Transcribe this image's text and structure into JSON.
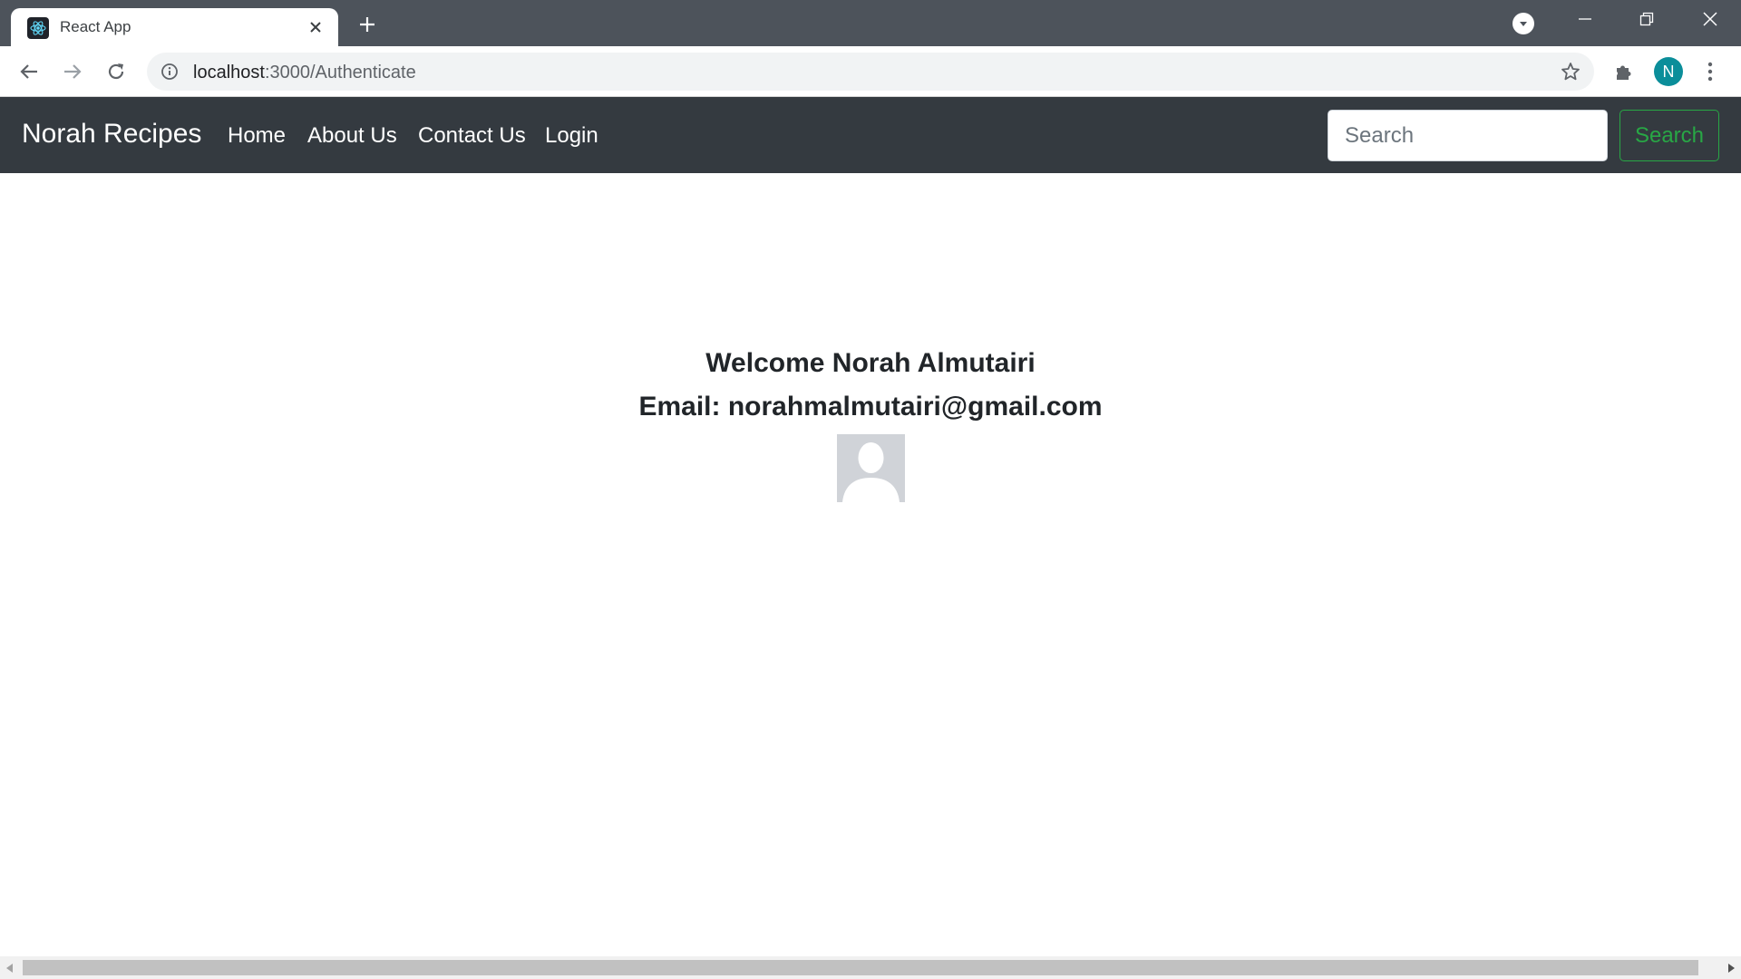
{
  "browser": {
    "tab_title": "React App",
    "url_host": "localhost",
    "url_path": ":3000/Authenticate",
    "profile_initial": "N",
    "profile_color": "#0b8e9a",
    "icons": [
      "react-favicon-icon",
      "close-icon",
      "plus-icon",
      "tab-search-icon",
      "minimize-icon",
      "restore-icon",
      "window-close-icon",
      "back-arrow-icon",
      "forward-arrow-icon",
      "reload-icon",
      "info-icon",
      "star-icon",
      "puzzle-icon",
      "kebab-menu-icon"
    ]
  },
  "navbar": {
    "brand": "Norah Recipes",
    "links": [
      "Home",
      "About Us",
      "Contact Us",
      "Login"
    ],
    "search_placeholder": "Search",
    "search_button": "Search",
    "background": "#343a40",
    "accent": "#28a745"
  },
  "main": {
    "welcome": "Welcome Norah Almutairi",
    "email": "Email: norahmalmutairi@gmail.com",
    "avatar_icon": "default-profile-icon"
  }
}
